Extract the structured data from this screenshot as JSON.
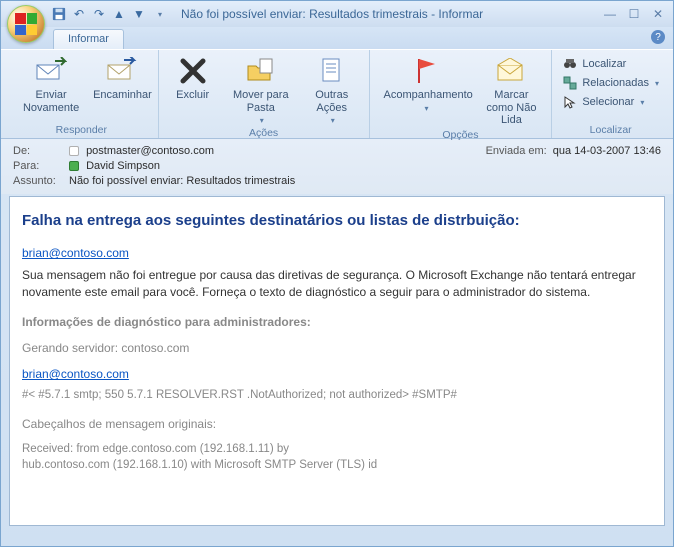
{
  "window": {
    "title": "Não foi possível enviar: Resultados trimestrais - Informar"
  },
  "qat": {
    "save": "save-icon",
    "undo": "undo-icon",
    "redo": "redo-icon",
    "prev": "prev-icon",
    "next": "next-icon"
  },
  "tab": {
    "label": "Informar"
  },
  "ribbon": {
    "responder": {
      "label": "Responder",
      "enviar": "Enviar Novamente",
      "encaminhar": "Encaminhar"
    },
    "acoes": {
      "label": "Ações",
      "excluir": "Excluir",
      "mover": "Mover para Pasta",
      "outras": "Outras Ações"
    },
    "opcoes": {
      "label": "Opções",
      "acompanhamento": "Acompanhamento",
      "naolida": "Marcar como Não Lida"
    },
    "localizar": {
      "label": "Localizar",
      "find": "Localizar",
      "relacionadas": "Relacionadas",
      "selecionar": "Selecionar"
    }
  },
  "headers": {
    "from_label": "De:",
    "from_value": "postmaster@contoso.com",
    "to_label": "Para:",
    "to_value": "David Simpson",
    "subject_label": "Assunto:",
    "subject_value": "Não foi possível enviar: Resultados trimestrais",
    "sent_label": "Enviada em:",
    "sent_value": "qua 14-03-2007 13:46"
  },
  "body": {
    "heading": "Falha na entrega aos seguintes destinatários ou listas de distrbuição:",
    "recipient_link": "brian@contoso.com",
    "recipient_msg": "Sua mensagem não foi entregue por causa das diretivas de segurança. O Microsoft Exchange não tentará entregar novamente este email para você. Forneça o texto de diagnóstico a seguir para o administrador do sistema.",
    "diag_heading": "Informações de diagnóstico para administradores:",
    "server_line": "Gerando servidor: contoso.com",
    "recipient_link2": "brian@contoso.com",
    "smtp_line": "#< #5.7.1 smtp; 550 5.7.1 RESOLVER.RST .NotAuthorized; not authorized> #SMTP#",
    "orig_headers": "Cabeçalhos de mensagem originais:",
    "received1": "Received: from edge.contoso.com (192.168.1.11) by",
    "received2": " hub.contoso.com (192.168.1.10) with Microsoft SMTP Server (TLS) id"
  }
}
